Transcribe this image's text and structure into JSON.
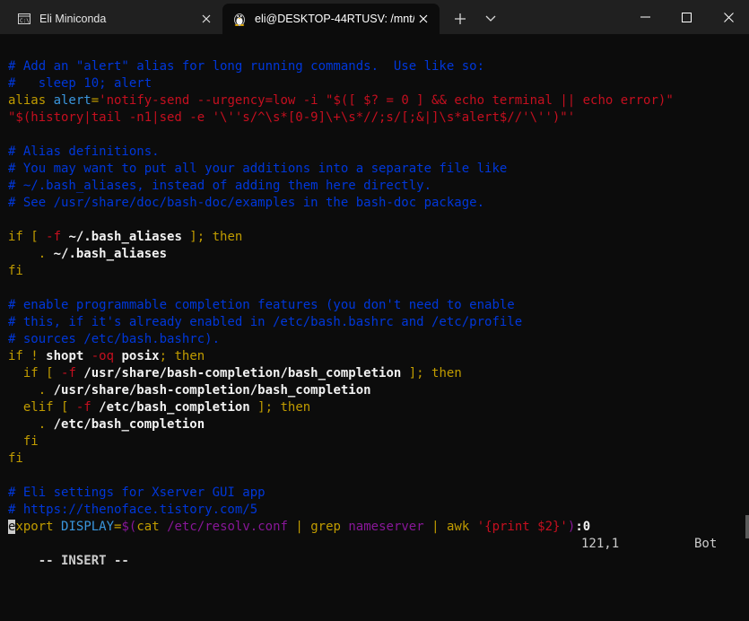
{
  "tabs": [
    {
      "label": "Eli Miniconda",
      "icon": "cmd-icon",
      "active": false
    },
    {
      "label": "eli@DESKTOP-44RTUSV: /mnt/",
      "icon": "linux-penguin-icon",
      "active": true
    }
  ],
  "window": {
    "new_tab_icon": "plus-icon",
    "dropdown_icon": "chevron-down-icon",
    "minimize_icon": "minimize-icon",
    "maximize_icon": "maximize-icon",
    "close_icon": "close-icon"
  },
  "colors": {
    "background": "#0c0c0c",
    "comment": "#0037da",
    "string": "#c50f1f",
    "keyword": "#c19c00",
    "identifier": "#3a96dd",
    "special": "#881798",
    "text": "#cccccc"
  },
  "editor": {
    "lines": [
      [
        {
          "t": "# Add an \"alert\" alias for long running commands.  Use like so:",
          "s": "c"
        }
      ],
      [
        {
          "t": "#   sleep 10; alert",
          "s": "c"
        }
      ],
      [
        {
          "t": "alias ",
          "s": "y"
        },
        {
          "t": "alert",
          "s": "cy"
        },
        {
          "t": "=",
          "s": "y"
        },
        {
          "t": "'notify-send --urgency=low -i \"$([ $? = 0 ] && echo terminal || echo error)\"",
          "s": "r"
        }
      ],
      [
        {
          "t": "\"$(history|tail -n1|sed -e '\\''s/^\\s*[0-9]\\+\\s*//;s/[;&|]\\s*alert$//'\\'')\"'",
          "s": "r"
        }
      ],
      [
        {
          "t": "",
          "s": "w"
        }
      ],
      [
        {
          "t": "# Alias definitions.",
          "s": "c"
        }
      ],
      [
        {
          "t": "# You may want to put all your additions into a separate file like",
          "s": "c"
        }
      ],
      [
        {
          "t": "# ~/.bash_aliases, instead of adding them here directly.",
          "s": "c"
        }
      ],
      [
        {
          "t": "# See /usr/share/doc/bash-doc/examples in the bash-doc package.",
          "s": "c"
        }
      ],
      [
        {
          "t": "",
          "s": "w"
        }
      ],
      [
        {
          "t": "if",
          "s": "y"
        },
        {
          "t": " [ ",
          "s": "y"
        },
        {
          "t": "-f",
          "s": "r"
        },
        {
          "t": " ~/.bash_aliases",
          "s": "b"
        },
        {
          "t": " ]; ",
          "s": "y"
        },
        {
          "t": "then",
          "s": "y"
        }
      ],
      [
        {
          "t": "    ",
          "s": "w"
        },
        {
          "t": ".",
          "s": "y"
        },
        {
          "t": " ~/.bash_aliases",
          "s": "b"
        }
      ],
      [
        {
          "t": "fi",
          "s": "y"
        }
      ],
      [
        {
          "t": "",
          "s": "w"
        }
      ],
      [
        {
          "t": "# enable programmable completion features (you don't need to enable",
          "s": "c"
        }
      ],
      [
        {
          "t": "# this, if it's already enabled in /etc/bash.bashrc and /etc/profile",
          "s": "c"
        }
      ],
      [
        {
          "t": "# sources /etc/bash.bashrc).",
          "s": "c"
        }
      ],
      [
        {
          "t": "if",
          "s": "y"
        },
        {
          "t": " ! ",
          "s": "y"
        },
        {
          "t": "shopt",
          "s": "b"
        },
        {
          "t": " -oq ",
          "s": "r"
        },
        {
          "t": "posix",
          "s": "b"
        },
        {
          "t": "; ",
          "s": "y"
        },
        {
          "t": "then",
          "s": "y"
        }
      ],
      [
        {
          "t": "  ",
          "s": "w"
        },
        {
          "t": "if",
          "s": "y"
        },
        {
          "t": " [ ",
          "s": "y"
        },
        {
          "t": "-f",
          "s": "r"
        },
        {
          "t": " /usr/share/bash-completion/bash_completion",
          "s": "b"
        },
        {
          "t": " ]; ",
          "s": "y"
        },
        {
          "t": "then",
          "s": "y"
        }
      ],
      [
        {
          "t": "    ",
          "s": "w"
        },
        {
          "t": ".",
          "s": "y"
        },
        {
          "t": " /usr/share/bash-completion/bash_completion",
          "s": "b"
        }
      ],
      [
        {
          "t": "  ",
          "s": "w"
        },
        {
          "t": "elif",
          "s": "y"
        },
        {
          "t": " [ ",
          "s": "y"
        },
        {
          "t": "-f",
          "s": "r"
        },
        {
          "t": " /etc/bash_completion",
          "s": "b"
        },
        {
          "t": " ]; ",
          "s": "y"
        },
        {
          "t": "then",
          "s": "y"
        }
      ],
      [
        {
          "t": "    ",
          "s": "w"
        },
        {
          "t": ".",
          "s": "y"
        },
        {
          "t": " /etc/bash_completion",
          "s": "b"
        }
      ],
      [
        {
          "t": "  ",
          "s": "w"
        },
        {
          "t": "fi",
          "s": "y"
        }
      ],
      [
        {
          "t": "fi",
          "s": "y"
        }
      ],
      [
        {
          "t": "",
          "s": "w"
        }
      ],
      [
        {
          "t": "# Eli settings for Xserver GUI app",
          "s": "c"
        }
      ],
      [
        {
          "t": "# https://thenoface.tistory.com/5",
          "s": "c"
        }
      ],
      [
        {
          "t": "e",
          "s": "cursor"
        },
        {
          "t": "xport",
          "s": "y"
        },
        {
          "t": " ",
          "s": "w"
        },
        {
          "t": "DISPLAY",
          "s": "cy"
        },
        {
          "t": "=",
          "s": "y"
        },
        {
          "t": "$(",
          "s": "m"
        },
        {
          "t": "cat",
          "s": "y"
        },
        {
          "t": " /etc/resolv.conf ",
          "s": "m"
        },
        {
          "t": "|",
          "s": "y"
        },
        {
          "t": " ",
          "s": "m"
        },
        {
          "t": "grep",
          "s": "y"
        },
        {
          "t": " nameserver ",
          "s": "m"
        },
        {
          "t": "|",
          "s": "y"
        },
        {
          "t": " ",
          "s": "m"
        },
        {
          "t": "awk",
          "s": "y"
        },
        {
          "t": " ",
          "s": "m"
        },
        {
          "t": "'{print $2}'",
          "s": "r"
        },
        {
          "t": ")",
          "s": "m"
        },
        {
          "t": ":0",
          "s": "b"
        }
      ]
    ],
    "status": {
      "mode": "-- INSERT --",
      "position": "121,1",
      "scroll": "Bot"
    }
  }
}
